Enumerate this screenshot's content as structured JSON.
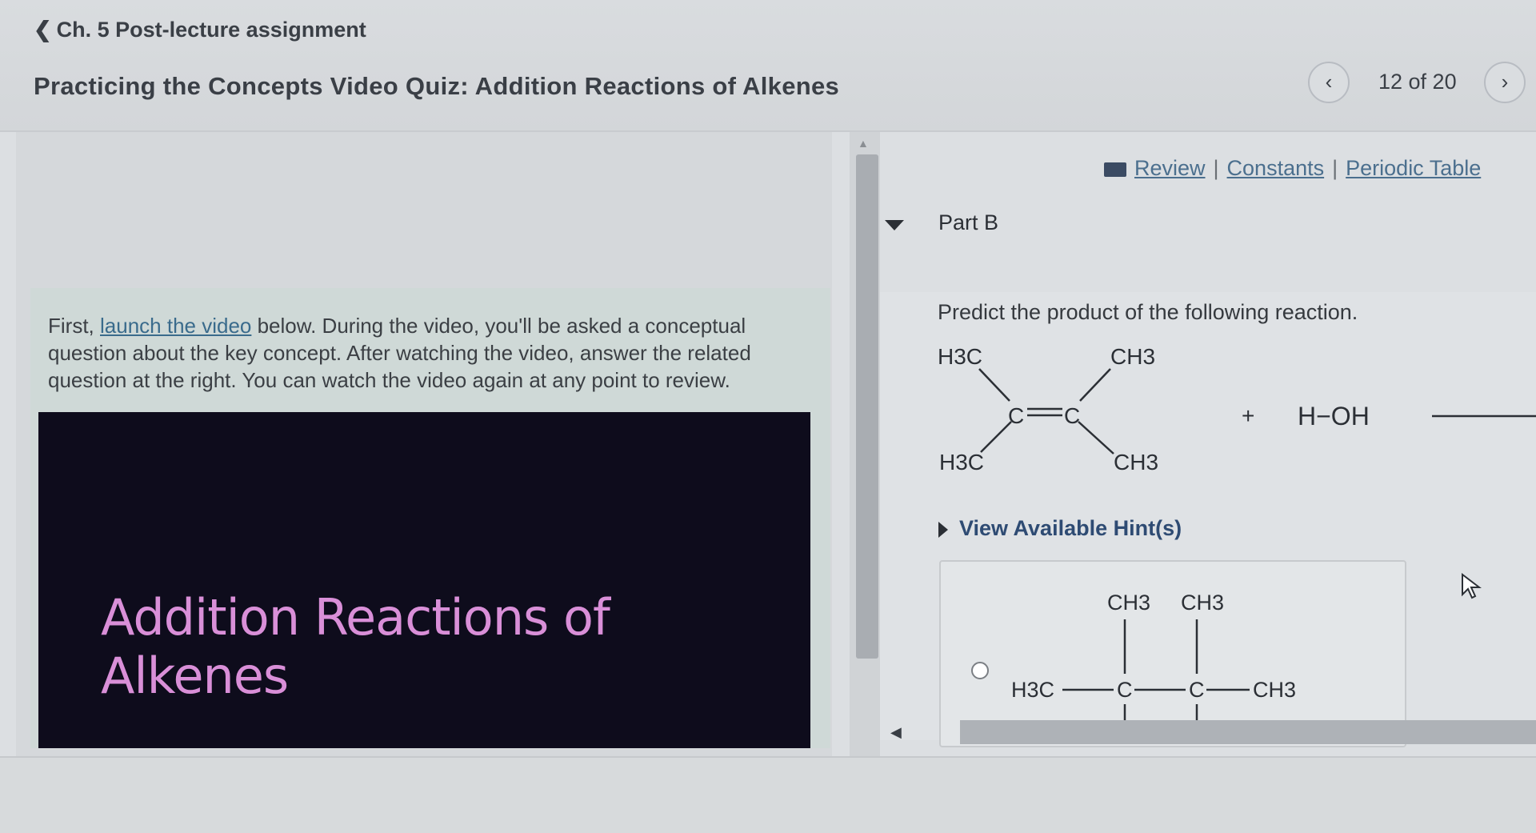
{
  "nav": {
    "back_label": "Ch. 5 Post-lecture assignment"
  },
  "header": {
    "title": "Practicing the Concepts Video Quiz: Addition Reactions of Alkenes"
  },
  "pager": {
    "prev_icon": "chevron-left-icon",
    "next_icon": "chevron-right-icon",
    "count": "12 of 20"
  },
  "left": {
    "intro_before": "First, ",
    "intro_link": "launch the video",
    "intro_after": " below. During the video, you'll be asked a conceptual question about the key concept. After watching the video, answer the related question at the right. You can watch the video again at any point to review.",
    "video_title": "Addition Reactions of Alkenes"
  },
  "right": {
    "links": {
      "review": "Review",
      "separator": "|",
      "constants": "Constants",
      "periodic": "Periodic Table"
    },
    "part_label": "Part B",
    "prompt": "Predict the product of the following reaction.",
    "reactant": {
      "top_left": "H3C",
      "top_right": "CH3",
      "bottom_left": "H3C",
      "bottom_right": "CH3",
      "atom": "C",
      "plus": "+",
      "reagent": "H−OH"
    },
    "hint_label": "View Available Hint(s)",
    "choice": {
      "left": "H3C",
      "c1": "C",
      "c2": "C",
      "right": "CH3",
      "top1": "CH3",
      "top2": "CH3"
    }
  },
  "colors": {
    "link": "#4b6f8e",
    "video_bg": "#0e0c1c",
    "video_title": "#d98fd8"
  }
}
